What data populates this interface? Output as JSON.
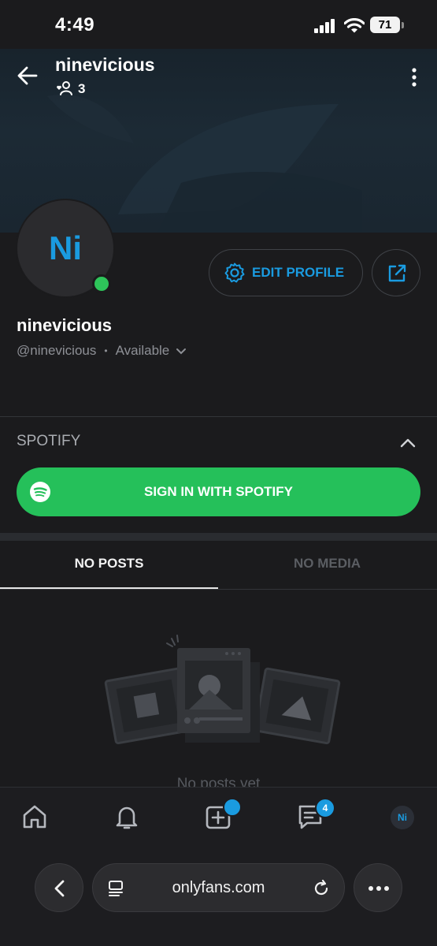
{
  "status_bar": {
    "time": "4:49",
    "battery": "71"
  },
  "header": {
    "title": "ninevicious",
    "fans_count": "3"
  },
  "profile": {
    "avatar_initials": "Ni",
    "display_name": "ninevicious",
    "handle": "@ninevicious",
    "separator": "•",
    "availability": "Available",
    "edit_profile_label": "EDIT PROFILE"
  },
  "spotify": {
    "section_title": "SPOTIFY",
    "button_label": "SIGN IN WITH SPOTIFY"
  },
  "tabs": [
    {
      "label": "NO POSTS",
      "active": true
    },
    {
      "label": "NO MEDIA",
      "active": false
    }
  ],
  "empty_state": {
    "text": "No posts yet"
  },
  "bottom_nav": {
    "items": [
      "home-icon",
      "bell-icon",
      "add-post-icon",
      "messages-icon",
      "profile-avatar"
    ],
    "messages_badge": "4",
    "avatar_initials": "Ni"
  },
  "browser": {
    "url": "onlyfans.com"
  },
  "colors": {
    "accent": "#1a9be0",
    "spotify_green": "#25c05a",
    "online": "#2ec55a",
    "background": "#1b1b1d"
  }
}
